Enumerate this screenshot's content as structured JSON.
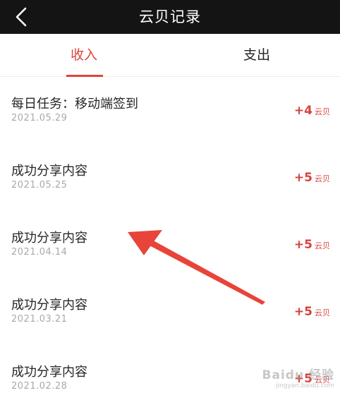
{
  "header": {
    "title": "云贝记录",
    "back_icon": "chevron-left-icon"
  },
  "tabs": [
    {
      "label": "收入",
      "active": true
    },
    {
      "label": "支出",
      "active": false
    }
  ],
  "records": [
    {
      "title": "每日任务：移动端签到",
      "date": "2021.05.29",
      "amount": "+4",
      "unit": "云贝"
    },
    {
      "title": "成功分享内容",
      "date": "2021.05.25",
      "amount": "+5",
      "unit": "云贝"
    },
    {
      "title": "成功分享内容",
      "date": "2021.04.14",
      "amount": "+5",
      "unit": "云贝"
    },
    {
      "title": "成功分享内容",
      "date": "2021.03.21",
      "amount": "+5",
      "unit": "云贝"
    },
    {
      "title": "成功分享内容",
      "date": "2021.02.28",
      "amount": "+5",
      "unit": "云贝"
    }
  ],
  "colors": {
    "accent": "#e0433a",
    "header_bg": "#141414",
    "annotation_arrow": "#e8443a"
  },
  "watermark": {
    "main": "Baidu 经验",
    "sub": "jingyan.baidu.com"
  }
}
